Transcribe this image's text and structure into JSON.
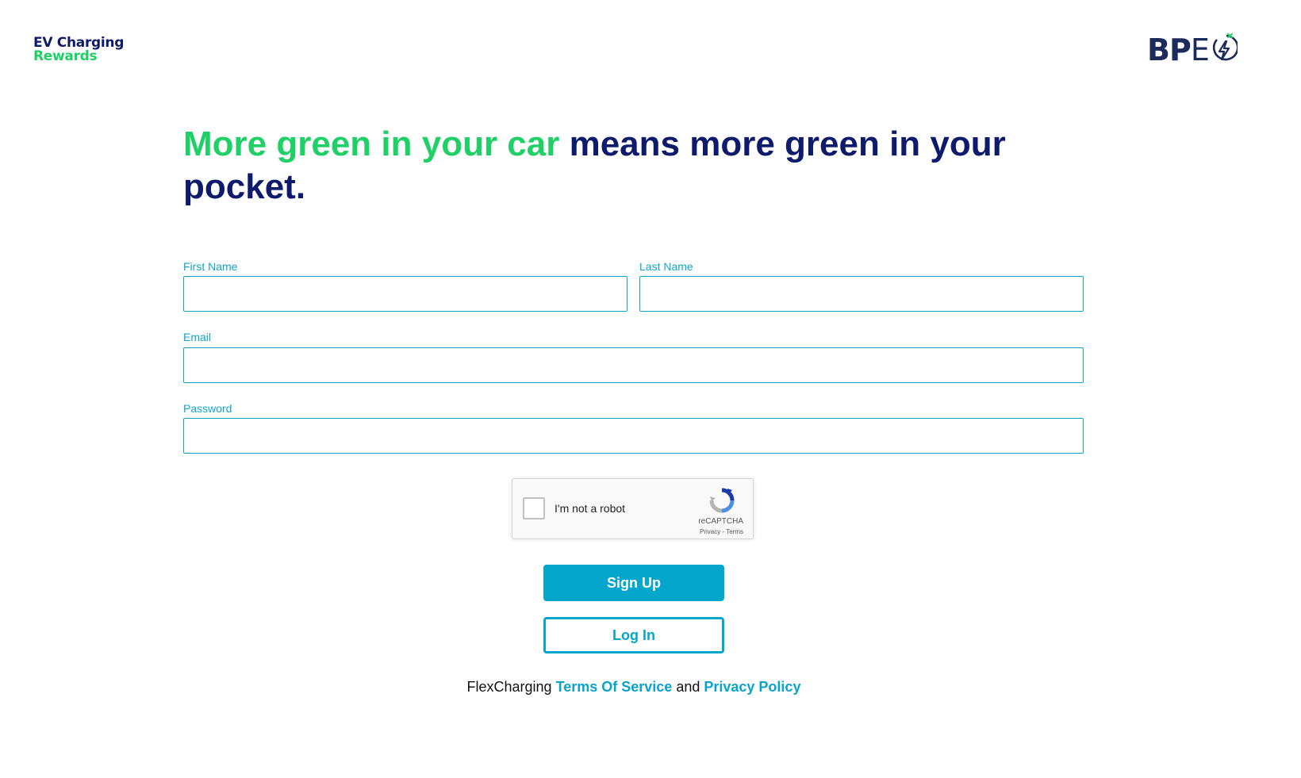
{
  "brand": {
    "line1": "EV Charging",
    "line2": "Rewards"
  },
  "partner": {
    "logo_text_bold": "BP",
    "logo_text_light": "E",
    "icon": "lightning-circle-icon"
  },
  "headline": {
    "green_part": "More green in your car",
    "rest_part": " means more green in your pocket."
  },
  "form": {
    "first_name_label": "First Name",
    "first_name_value": "",
    "last_name_label": "Last Name",
    "last_name_value": "",
    "email_label": "Email",
    "email_value": "",
    "password_label": "Password",
    "password_value": ""
  },
  "captcha": {
    "label": "I'm not a robot",
    "brand": "reCAPTCHA",
    "links": "Privacy - Terms",
    "icon": "recaptcha-icon"
  },
  "buttons": {
    "signup": "Sign Up",
    "login": "Log In"
  },
  "footer": {
    "prefix": "FlexCharging ",
    "terms": "Terms Of Service",
    "middle": " and ",
    "privacy": "Privacy Policy"
  },
  "colors": {
    "navy": "#0e1a6b",
    "green": "#1fd067",
    "accent": "#05a6cc"
  }
}
